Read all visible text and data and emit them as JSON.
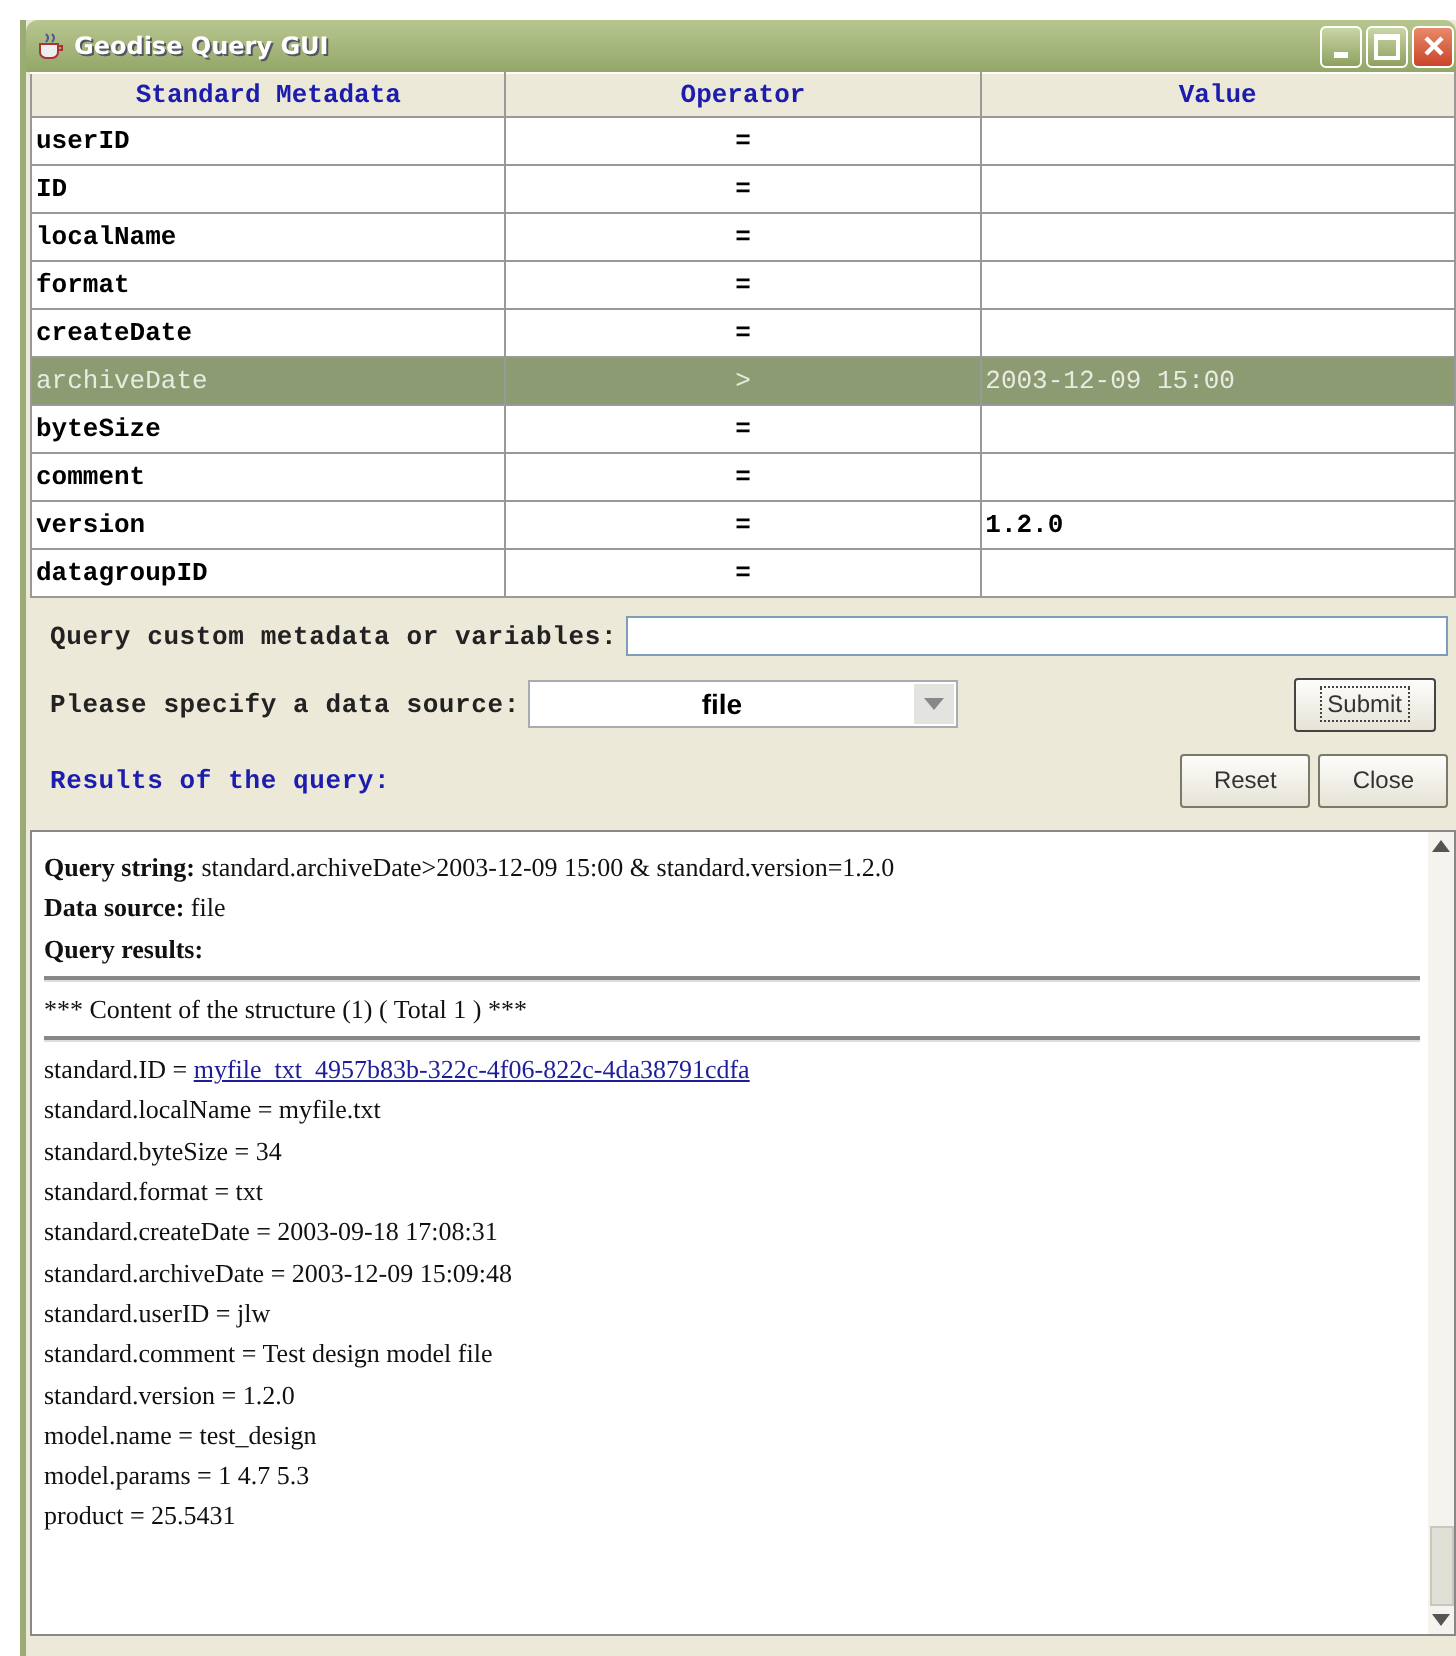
{
  "window": {
    "title": "Geodise Query GUI"
  },
  "table": {
    "columns": [
      "Standard Metadata",
      "Operator",
      "Value"
    ],
    "rows": [
      {
        "name": "userID",
        "operator": "=",
        "value": "",
        "selected": false
      },
      {
        "name": "ID",
        "operator": "=",
        "value": "",
        "selected": false
      },
      {
        "name": "localName",
        "operator": "=",
        "value": "",
        "selected": false
      },
      {
        "name": "format",
        "operator": "=",
        "value": "",
        "selected": false
      },
      {
        "name": "createDate",
        "operator": "=",
        "value": "",
        "selected": false
      },
      {
        "name": "archiveDate",
        "operator": ">",
        "value": "2003-12-09 15:00",
        "selected": true
      },
      {
        "name": "byteSize",
        "operator": "=",
        "value": "",
        "selected": false
      },
      {
        "name": "comment",
        "operator": "=",
        "value": "",
        "selected": false
      },
      {
        "name": "version",
        "operator": "=",
        "value": "1.2.0",
        "selected": false
      },
      {
        "name": "datagroupID",
        "operator": "=",
        "value": "",
        "selected": false
      }
    ]
  },
  "custom_query": {
    "label": "Query custom metadata or variables:"
  },
  "data_source": {
    "label": "Please specify a data source:",
    "value": "file"
  },
  "buttons": [
    {
      "label": "Submit",
      "focused": true
    },
    {
      "label": "Reset",
      "focused": false
    },
    {
      "label": "Close",
      "focused": false
    }
  ],
  "results_label": "Results of the query:",
  "results": {
    "header": [
      "**Query string:** standard.archiveDate>2003-12-09 15:00 & standard.version=1.2.0",
      "**Data source:** file",
      "**Query results:**"
    ],
    "structure_title": "*** Content of the structure (1) ( Total 1 ) ***",
    "lines": [
      {
        "text": "standard.ID = ",
        "link": "myfile_txt_4957b83b-322c-4f06-822c-4da38791cdfa"
      },
      {
        "text": "standard.localName = myfile.txt"
      },
      {
        "text": "standard.byteSize = 34"
      },
      {
        "text": "standard.format = txt"
      },
      {
        "text": "standard.createDate = 2003-09-18 17:08:31"
      },
      {
        "text": "standard.archiveDate = 2003-12-09 15:09:48"
      },
      {
        "text": "standard.userID = jlw"
      },
      {
        "text": "standard.comment = Test design model file"
      },
      {
        "text": "standard.version = 1.2.0"
      },
      {
        "text": "model.name = test_design"
      },
      {
        "text": "model.params = 1 4.7 5.3"
      },
      {
        "text": "product = 25.5431"
      }
    ]
  }
}
